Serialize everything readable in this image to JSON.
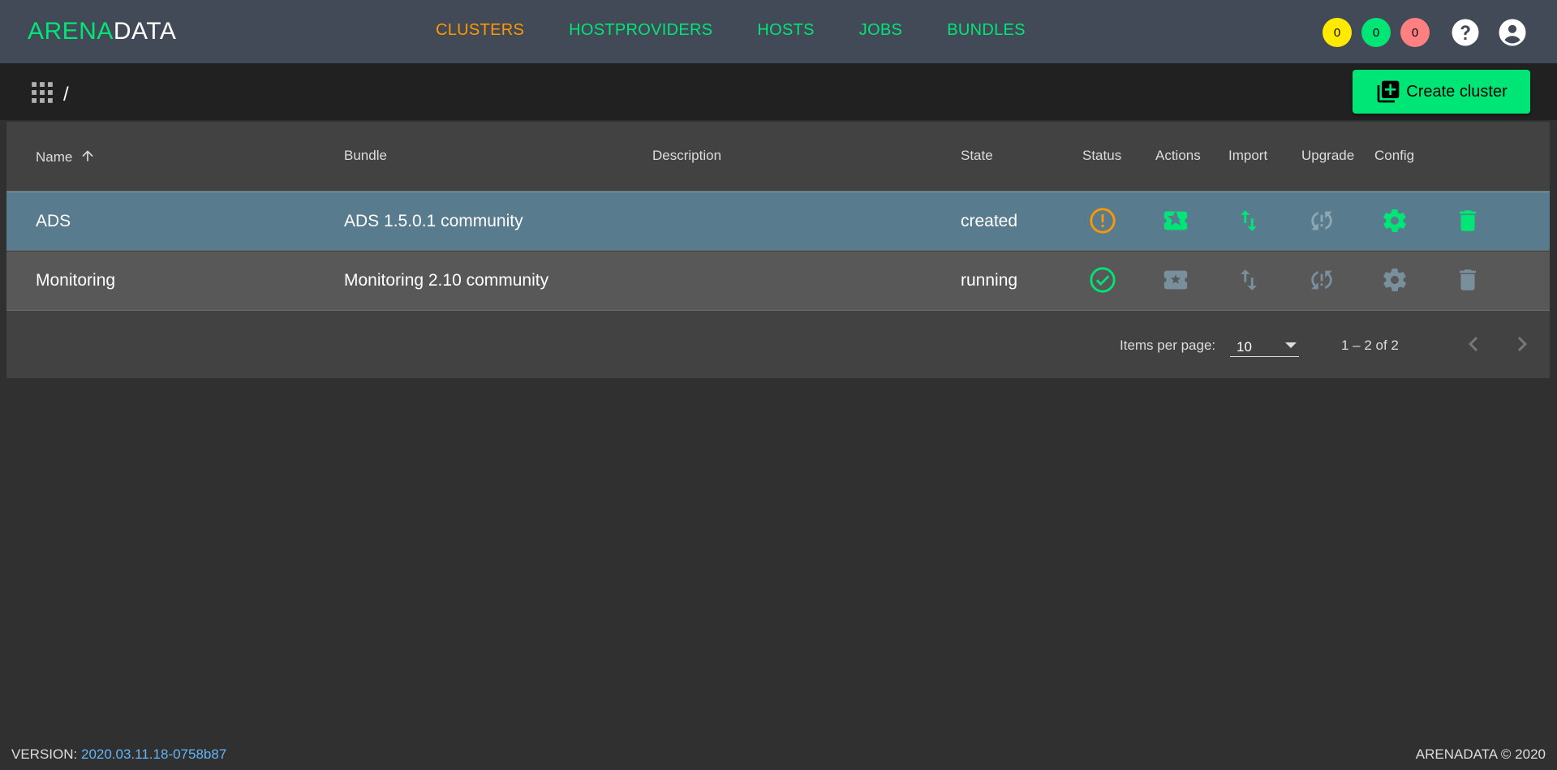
{
  "brand": {
    "logo_part1": "ARENA",
    "logo_part2": "DATA"
  },
  "nav": {
    "items": [
      {
        "label": "CLUSTERS",
        "active": true
      },
      {
        "label": "HOSTPROVIDERS",
        "active": false
      },
      {
        "label": "HOSTS",
        "active": false
      },
      {
        "label": "JOBS",
        "active": false
      },
      {
        "label": "BUNDLES",
        "active": false
      }
    ]
  },
  "badges": [
    {
      "count": "0",
      "color": "#ffea00"
    },
    {
      "count": "0",
      "color": "#00e676"
    },
    {
      "count": "0",
      "color": "#ff8080"
    }
  ],
  "header_icons": [
    "help-icon",
    "account-circle-icon"
  ],
  "breadcrumb": {
    "separator": "/"
  },
  "create_button": {
    "label": "Create cluster"
  },
  "table": {
    "columns": [
      "Name",
      "Bundle",
      "Description",
      "State",
      "Status",
      "Actions",
      "Import",
      "Upgrade",
      "Config"
    ],
    "sort": {
      "column": "Name",
      "direction": "asc"
    },
    "rows": [
      {
        "name": "ADS",
        "bundle": "ADS 1.5.0.1 community",
        "description": "",
        "state": "created",
        "status": "warning",
        "selected": true
      },
      {
        "name": "Monitoring",
        "bundle": "Monitoring 2.10 community",
        "description": "",
        "state": "running",
        "status": "ok",
        "selected": false
      }
    ]
  },
  "paginator": {
    "items_per_page_label": "Items per page:",
    "items_per_page": "10",
    "range": "1 – 2 of 2"
  },
  "footer": {
    "version_label": "VERSION:",
    "version": "2020.03.11.18-0758b87",
    "copyright": "ARENADATA © 2020"
  },
  "colors": {
    "accent_green": "#00e676",
    "active_orange": "#ff9800",
    "selected_row": "#587c8e",
    "disabled_icon": "#78909c"
  }
}
